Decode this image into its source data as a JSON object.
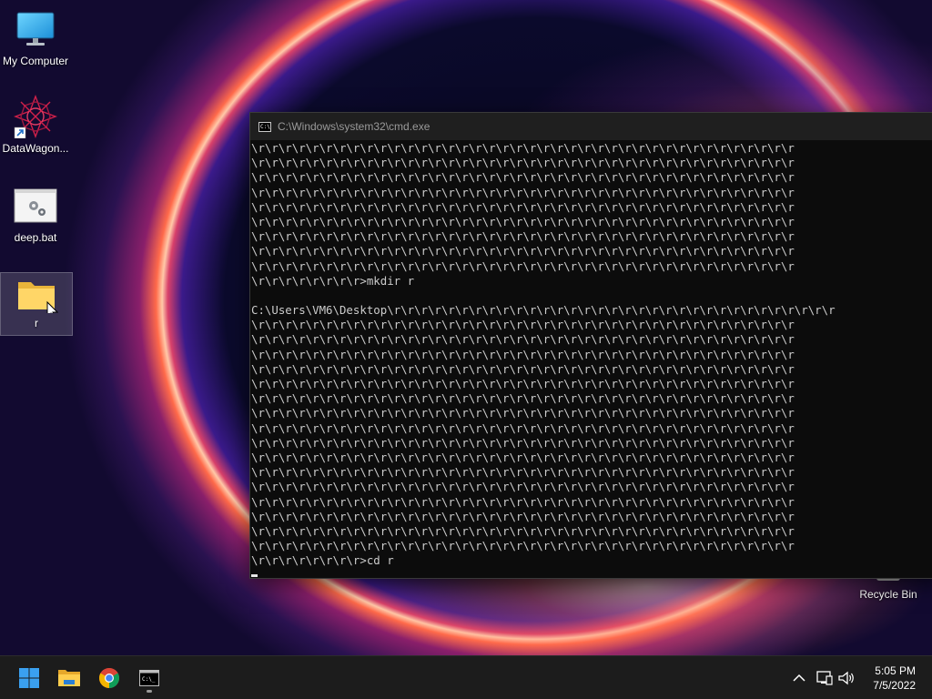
{
  "desktop": {
    "icons": [
      {
        "label": "My Computer",
        "icon": "monitor-icon"
      },
      {
        "label": "DataWagon...",
        "icon": "datawagon-app-icon",
        "shortcut": true
      },
      {
        "label": "deep.bat",
        "icon": "batch-file-icon"
      },
      {
        "label": "r",
        "icon": "folder-icon",
        "selected": true
      }
    ],
    "recycle_bin": {
      "label": "Recycle Bin",
      "icon": "recycle-bin-icon"
    }
  },
  "cmd_window": {
    "title": "C:\\Windows\\system32\\cmd.exe",
    "icon": "cmd-icon",
    "background": "#0c0c0c",
    "text_color": "#cccccc",
    "lines": [
      "\\r\\r\\r\\r\\r\\r\\r\\r\\r\\r\\r\\r\\r\\r\\r\\r\\r\\r\\r\\r\\r\\r\\r\\r\\r\\r\\r\\r\\r\\r\\r\\r\\r\\r\\r\\r\\r\\r\\r\\r",
      "\\r\\r\\r\\r\\r\\r\\r\\r\\r\\r\\r\\r\\r\\r\\r\\r\\r\\r\\r\\r\\r\\r\\r\\r\\r\\r\\r\\r\\r\\r\\r\\r\\r\\r\\r\\r\\r\\r\\r\\r",
      "\\r\\r\\r\\r\\r\\r\\r\\r\\r\\r\\r\\r\\r\\r\\r\\r\\r\\r\\r\\r\\r\\r\\r\\r\\r\\r\\r\\r\\r\\r\\r\\r\\r\\r\\r\\r\\r\\r\\r\\r",
      "\\r\\r\\r\\r\\r\\r\\r\\r\\r\\r\\r\\r\\r\\r\\r\\r\\r\\r\\r\\r\\r\\r\\r\\r\\r\\r\\r\\r\\r\\r\\r\\r\\r\\r\\r\\r\\r\\r\\r\\r",
      "\\r\\r\\r\\r\\r\\r\\r\\r\\r\\r\\r\\r\\r\\r\\r\\r\\r\\r\\r\\r\\r\\r\\r\\r\\r\\r\\r\\r\\r\\r\\r\\r\\r\\r\\r\\r\\r\\r\\r\\r",
      "\\r\\r\\r\\r\\r\\r\\r\\r\\r\\r\\r\\r\\r\\r\\r\\r\\r\\r\\r\\r\\r\\r\\r\\r\\r\\r\\r\\r\\r\\r\\r\\r\\r\\r\\r\\r\\r\\r\\r\\r",
      "\\r\\r\\r\\r\\r\\r\\r\\r\\r\\r\\r\\r\\r\\r\\r\\r\\r\\r\\r\\r\\r\\r\\r\\r\\r\\r\\r\\r\\r\\r\\r\\r\\r\\r\\r\\r\\r\\r\\r\\r",
      "\\r\\r\\r\\r\\r\\r\\r\\r\\r\\r\\r\\r\\r\\r\\r\\r\\r\\r\\r\\r\\r\\r\\r\\r\\r\\r\\r\\r\\r\\r\\r\\r\\r\\r\\r\\r\\r\\r\\r\\r",
      "\\r\\r\\r\\r\\r\\r\\r\\r\\r\\r\\r\\r\\r\\r\\r\\r\\r\\r\\r\\r\\r\\r\\r\\r\\r\\r\\r\\r\\r\\r\\r\\r\\r\\r\\r\\r\\r\\r\\r\\r",
      "\\r\\r\\r\\r\\r\\r\\r\\r>mkdir r",
      "",
      "C:\\Users\\VM6\\Desktop\\r\\r\\r\\r\\r\\r\\r\\r\\r\\r\\r\\r\\r\\r\\r\\r\\r\\r\\r\\r\\r\\r\\r\\r\\r\\r\\r\\r\\r\\r\\r\\r\\r",
      "\\r\\r\\r\\r\\r\\r\\r\\r\\r\\r\\r\\r\\r\\r\\r\\r\\r\\r\\r\\r\\r\\r\\r\\r\\r\\r\\r\\r\\r\\r\\r\\r\\r\\r\\r\\r\\r\\r\\r\\r",
      "\\r\\r\\r\\r\\r\\r\\r\\r\\r\\r\\r\\r\\r\\r\\r\\r\\r\\r\\r\\r\\r\\r\\r\\r\\r\\r\\r\\r\\r\\r\\r\\r\\r\\r\\r\\r\\r\\r\\r\\r",
      "\\r\\r\\r\\r\\r\\r\\r\\r\\r\\r\\r\\r\\r\\r\\r\\r\\r\\r\\r\\r\\r\\r\\r\\r\\r\\r\\r\\r\\r\\r\\r\\r\\r\\r\\r\\r\\r\\r\\r\\r",
      "\\r\\r\\r\\r\\r\\r\\r\\r\\r\\r\\r\\r\\r\\r\\r\\r\\r\\r\\r\\r\\r\\r\\r\\r\\r\\r\\r\\r\\r\\r\\r\\r\\r\\r\\r\\r\\r\\r\\r\\r",
      "\\r\\r\\r\\r\\r\\r\\r\\r\\r\\r\\r\\r\\r\\r\\r\\r\\r\\r\\r\\r\\r\\r\\r\\r\\r\\r\\r\\r\\r\\r\\r\\r\\r\\r\\r\\r\\r\\r\\r\\r",
      "\\r\\r\\r\\r\\r\\r\\r\\r\\r\\r\\r\\r\\r\\r\\r\\r\\r\\r\\r\\r\\r\\r\\r\\r\\r\\r\\r\\r\\r\\r\\r\\r\\r\\r\\r\\r\\r\\r\\r\\r",
      "\\r\\r\\r\\r\\r\\r\\r\\r\\r\\r\\r\\r\\r\\r\\r\\r\\r\\r\\r\\r\\r\\r\\r\\r\\r\\r\\r\\r\\r\\r\\r\\r\\r\\r\\r\\r\\r\\r\\r\\r",
      "\\r\\r\\r\\r\\r\\r\\r\\r\\r\\r\\r\\r\\r\\r\\r\\r\\r\\r\\r\\r\\r\\r\\r\\r\\r\\r\\r\\r\\r\\r\\r\\r\\r\\r\\r\\r\\r\\r\\r\\r",
      "\\r\\r\\r\\r\\r\\r\\r\\r\\r\\r\\r\\r\\r\\r\\r\\r\\r\\r\\r\\r\\r\\r\\r\\r\\r\\r\\r\\r\\r\\r\\r\\r\\r\\r\\r\\r\\r\\r\\r\\r",
      "\\r\\r\\r\\r\\r\\r\\r\\r\\r\\r\\r\\r\\r\\r\\r\\r\\r\\r\\r\\r\\r\\r\\r\\r\\r\\r\\r\\r\\r\\r\\r\\r\\r\\r\\r\\r\\r\\r\\r\\r",
      "\\r\\r\\r\\r\\r\\r\\r\\r\\r\\r\\r\\r\\r\\r\\r\\r\\r\\r\\r\\r\\r\\r\\r\\r\\r\\r\\r\\r\\r\\r\\r\\r\\r\\r\\r\\r\\r\\r\\r\\r",
      "\\r\\r\\r\\r\\r\\r\\r\\r\\r\\r\\r\\r\\r\\r\\r\\r\\r\\r\\r\\r\\r\\r\\r\\r\\r\\r\\r\\r\\r\\r\\r\\r\\r\\r\\r\\r\\r\\r\\r\\r",
      "\\r\\r\\r\\r\\r\\r\\r\\r\\r\\r\\r\\r\\r\\r\\r\\r\\r\\r\\r\\r\\r\\r\\r\\r\\r\\r\\r\\r\\r\\r\\r\\r\\r\\r\\r\\r\\r\\r\\r\\r",
      "\\r\\r\\r\\r\\r\\r\\r\\r\\r\\r\\r\\r\\r\\r\\r\\r\\r\\r\\r\\r\\r\\r\\r\\r\\r\\r\\r\\r\\r\\r\\r\\r\\r\\r\\r\\r\\r\\r\\r\\r",
      "\\r\\r\\r\\r\\r\\r\\r\\r\\r\\r\\r\\r\\r\\r\\r\\r\\r\\r\\r\\r\\r\\r\\r\\r\\r\\r\\r\\r\\r\\r\\r\\r\\r\\r\\r\\r\\r\\r\\r\\r",
      "\\r\\r\\r\\r\\r\\r\\r\\r\\r\\r\\r\\r\\r\\r\\r\\r\\r\\r\\r\\r\\r\\r\\r\\r\\r\\r\\r\\r\\r\\r\\r\\r\\r\\r\\r\\r\\r\\r\\r\\r",
      "\\r\\r\\r\\r\\r\\r\\r\\r>cd r"
    ]
  },
  "taskbar": {
    "buttons": [
      {
        "name": "start-button",
        "icon": "windows-logo-icon"
      },
      {
        "name": "file-explorer-button",
        "icon": "folder-icon"
      },
      {
        "name": "chrome-button",
        "icon": "chrome-icon"
      },
      {
        "name": "cmd-taskbar-button",
        "icon": "cmd-icon",
        "active": true
      }
    ],
    "tray": {
      "icons": [
        "chevron-up-icon",
        "network-icon",
        "speaker-icon"
      ],
      "time": "5:05 PM",
      "date": "7/5/2022"
    }
  }
}
